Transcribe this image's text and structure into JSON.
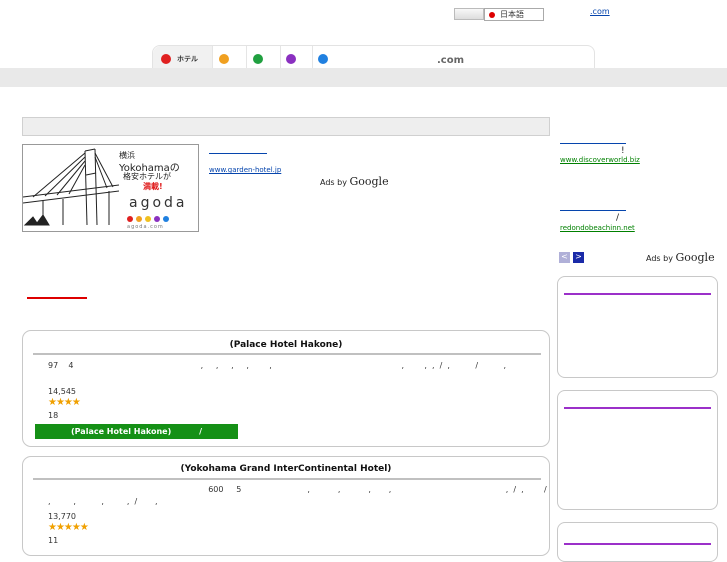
{
  "header": {
    "language": "日本語",
    "top_link": ".com"
  },
  "tabs": [
    {
      "label": "ホテル",
      "color": "#e02020",
      "active": true
    },
    {
      "label": "",
      "color": "#f0a020",
      "active": false
    },
    {
      "label": "",
      "color": "#20a040",
      "active": false
    },
    {
      "label": "",
      "color": "#8a30c0",
      "active": false
    },
    {
      "label": "",
      "color": "#2080e0",
      "active": false
    }
  ],
  "tabs_suffix": ".com",
  "banner": {
    "line1": "横浜",
    "line2": "Yokohamaの",
    "line3": "格安ホテルが",
    "line4": "満載!",
    "brand": "agoda",
    "url": "agoda.com",
    "dot_colors": [
      "#e02020",
      "#f0a020",
      "#f0c020",
      "#8a30c0",
      "#2080e0"
    ]
  },
  "ad_main": {
    "url": "www.garden-hotel.jp",
    "ads_by": "Ads by",
    "google": "Google"
  },
  "ad_right": [
    {
      "title_suffix": "!",
      "url": "www.discoverworld.biz"
    },
    {
      "title_suffix": "/",
      "url": "redondobeachinn.net"
    }
  ],
  "ad_right_footer": {
    "ads_by": "Ads by",
    "google": "Google",
    "prev": "<",
    "next": ">"
  },
  "hotels": [
    {
      "title": "(Palace Hotel Hakone)",
      "desc_line1": "97    4                                                  ,     ,     ,     ,        ,                                                   ,        ,  ,  /  ,          /          ,                                ,        ,       ,",
      "price": "14,545",
      "stars": "★★★★",
      "reviews": "18",
      "button": "(Palace Hotel Hakone)          /                  /"
    },
    {
      "title": "(Yokohama Grand InterContinental Hotel)",
      "desc_line1": "                                                               600     5                          ,           ,           ,       ,                                             ,  /  ,        /",
      "desc_line2": ",         ,          ,         ,  /       ,",
      "price": "13,770",
      "stars": "★★★★★",
      "reviews": "11"
    }
  ]
}
